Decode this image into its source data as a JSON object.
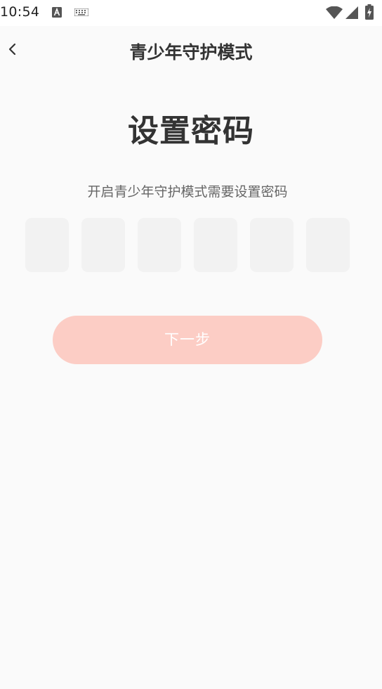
{
  "status_bar": {
    "time": "10:54",
    "icons": [
      "a-icon",
      "keyboard-icon",
      "wifi-icon",
      "signal-icon",
      "battery-icon"
    ]
  },
  "header": {
    "title": "青少年守护模式",
    "back_icon": "chevron-left-icon"
  },
  "main": {
    "heading": "设置密码",
    "description": "开启青少年守护模式需要设置密码",
    "pin_length": 6,
    "pin_values": [
      "",
      "",
      "",
      "",
      "",
      ""
    ],
    "next_label": "下一步"
  },
  "colors": {
    "background": "#fafafa",
    "pin_box": "#f2f2f2",
    "button_disabled": "#fccdc5",
    "button_text": "#ffffff",
    "title_text": "#333333",
    "description_text": "#666666"
  }
}
